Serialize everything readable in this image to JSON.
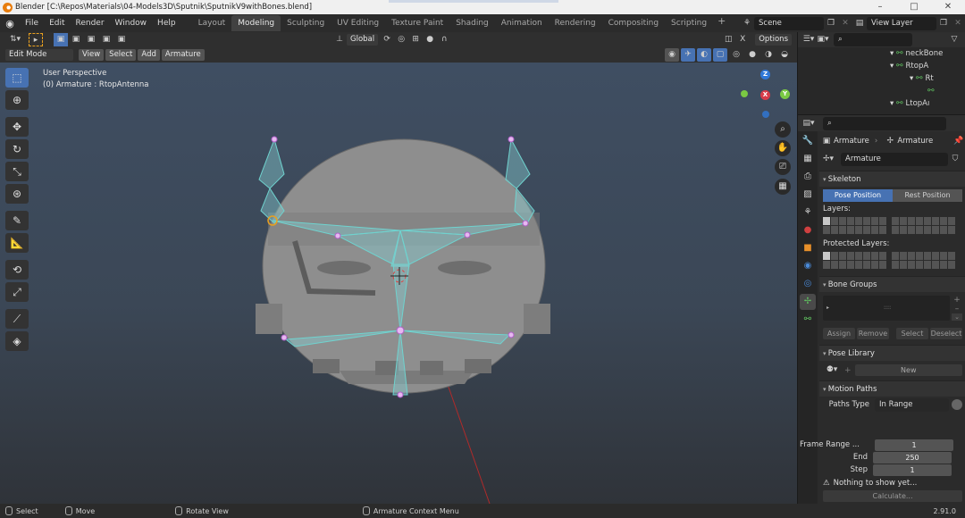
{
  "window": {
    "title": "Blender [C:\\Repos\\Materials\\04-Models3D\\Sputnik\\SputnikV9withBones.blend]",
    "minimize": "–",
    "maximize": "□",
    "close": "✕"
  },
  "menu": [
    "File",
    "Edit",
    "Render",
    "Window",
    "Help"
  ],
  "workspaces": [
    "Layout",
    "Modeling",
    "Sculpting",
    "UV Editing",
    "Texture Paint",
    "Shading",
    "Animation",
    "Rendering",
    "Compositing",
    "Scripting"
  ],
  "active_workspace": "Modeling",
  "scene_name": "Scene",
  "view_layer": "View Layer",
  "viewport_header": {
    "transform_orientation": "Global",
    "options_label": "Options",
    "xray_label": "X",
    "mode": "Edit Mode",
    "view": "View",
    "select": "Select",
    "add": "Add",
    "armature": "Armature"
  },
  "viewport": {
    "perspective": "User Perspective",
    "object_info": "(0) Armature : RtopAntenna",
    "gizmo": {
      "z": "Z",
      "x": "X",
      "y": "Y"
    }
  },
  "outliner": {
    "items": [
      {
        "label": "neckBone",
        "depth": 3
      },
      {
        "label": "RtopA",
        "depth": 4
      },
      {
        "label": "Rt",
        "depth": 5
      },
      {
        "label": "",
        "depth": 6
      },
      {
        "label": "LtopAı",
        "depth": 4
      }
    ]
  },
  "properties": {
    "breadcrumb_object": "Armature",
    "breadcrumb_data": "Armature",
    "data_name": "Armature",
    "skeleton": {
      "title": "Skeleton",
      "pose_position": "Pose Position",
      "rest_position": "Rest Position",
      "layers_label": "Layers:",
      "protected_label": "Protected Layers:"
    },
    "bone_groups": {
      "title": "Bone Groups",
      "assign": "Assign",
      "remove": "Remove",
      "select": "Select",
      "deselect": "Deselect"
    },
    "pose_library": {
      "title": "Pose Library",
      "new": "New"
    },
    "motion_paths": {
      "title": "Motion Paths",
      "paths_type_label": "Paths Type",
      "paths_type_value": "In Range",
      "frame_range_label": "Frame Range ...",
      "frame_start": "1",
      "end_label": "End",
      "frame_end": "250",
      "step_label": "Step",
      "step": "1",
      "warning": "Nothing to show yet...",
      "calculate": "Calculate..."
    }
  },
  "statusbar": {
    "select": "Select",
    "move": "Move",
    "rotate": "Rotate View",
    "context": "Armature Context Menu",
    "version": "2.91.0"
  },
  "colors": {
    "accent": "#4772b3",
    "bone": "#6fd3cf",
    "joint": "#c878d8",
    "mesh": "#8c8c8c"
  }
}
